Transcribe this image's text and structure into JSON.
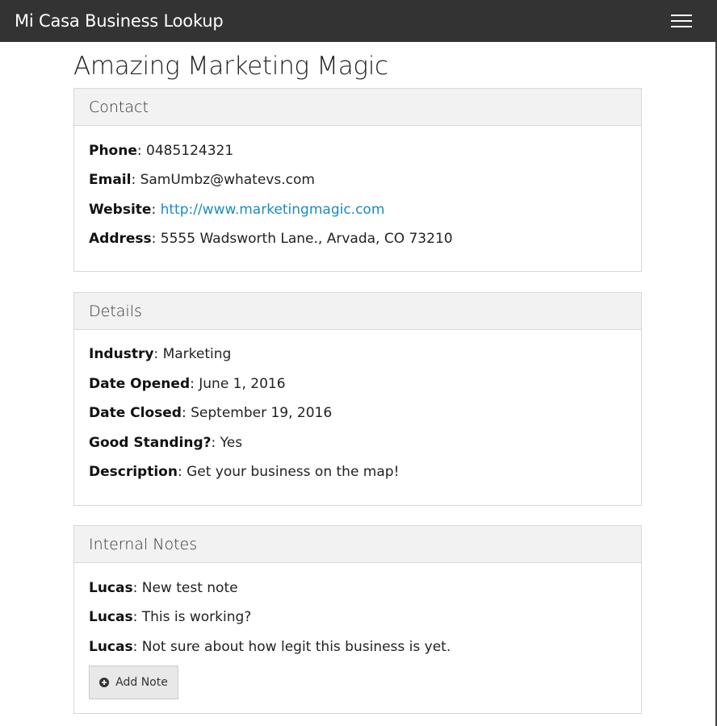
{
  "navbar": {
    "brand": "Mi Casa Business Lookup",
    "menu_icon": "hamburger-icon"
  },
  "business": {
    "name": "Amazing Marketing Magic"
  },
  "contact": {
    "heading": "Contact",
    "fields": [
      {
        "label": "Phone",
        "value": "0485124321"
      },
      {
        "label": "Email",
        "value": "SamUmbz@whatevs.com"
      },
      {
        "label": "Website",
        "value": "http://www.marketingmagic.com"
      },
      {
        "label": "Address",
        "value": "5555 Wadsworth Lane., Arvada, CO 73210"
      }
    ]
  },
  "details": {
    "heading": "Details",
    "fields": [
      {
        "label": "Industry",
        "value": "Marketing"
      },
      {
        "label": "Date Opened",
        "value": "June 1, 2016"
      },
      {
        "label": "Date Closed",
        "value": "September 19, 2016"
      },
      {
        "label": "Good Standing?",
        "value": "Yes"
      },
      {
        "label": "Description",
        "value": "Get your business on the map!"
      }
    ]
  },
  "notes": {
    "heading": "Internal Notes",
    "items": [
      {
        "author": "Lucas",
        "text": "New test note"
      },
      {
        "author": "Lucas",
        "text": "This is working?"
      },
      {
        "author": "Lucas",
        "text": "Not sure about how legit this business is yet."
      }
    ],
    "add_button_label": "Add Note",
    "add_button_icon": "plus-circle-icon"
  },
  "colors": {
    "navbar_bg": "#333333",
    "link": "#1a8bc0",
    "panel_heading_bg": "#f2f2f2"
  }
}
